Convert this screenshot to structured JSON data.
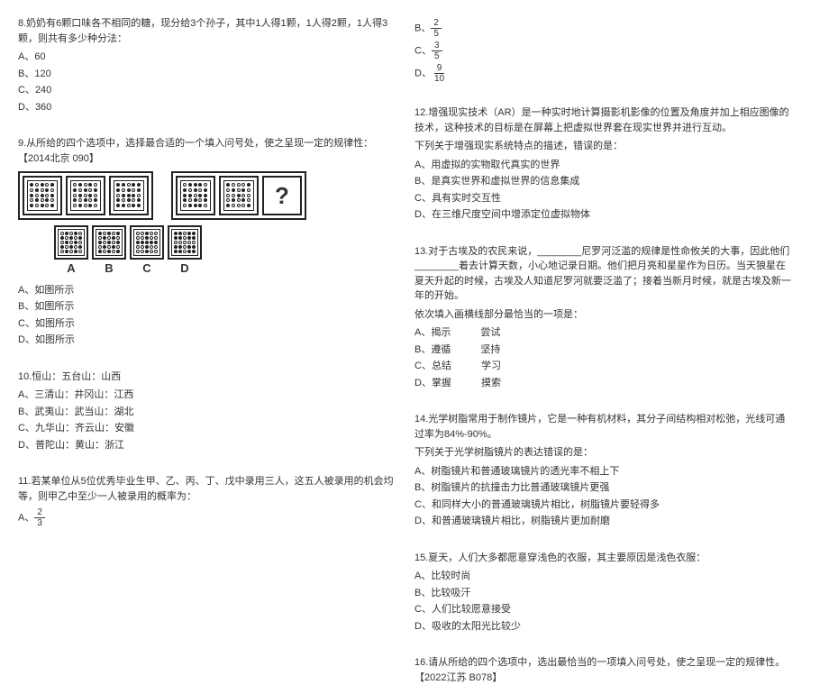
{
  "col1": {
    "q8": {
      "stem": "8.奶奶有6颗口味各不相同的糖，现分给3个孙子，其中1人得1颗，1人得2颗，1人得3颗，则共有多少种分法：",
      "opts": {
        "a": "A、60",
        "b": "B、120",
        "c": "C、240",
        "d": "D、360"
      }
    },
    "q9": {
      "stem": "9.从所给的四个选项中，选择最合适的一个填入问号处，使之呈现一定的规律性：【2014北京 090】",
      "qmark": "?",
      "ans_labels": {
        "a": "A",
        "b": "B",
        "c": "C",
        "d": "D"
      },
      "opts": {
        "a": "A、如图所示",
        "b": "B、如图所示",
        "c": "C、如图所示",
        "d": "D、如图所示"
      }
    },
    "q10": {
      "stem": "10.恒山：五台山：山西",
      "opts": {
        "a": "A、三清山：井冈山：江西",
        "b": "B、武夷山：武当山：湖北",
        "c": "C、九华山：齐云山：安徽",
        "d": "D、普陀山：黄山：浙江"
      }
    },
    "q11": {
      "stem": "11.若某单位从5位优秀毕业生甲、乙、丙、丁、戊中录用三人，这五人被录用的机会均等，则甲乙中至少一人被录用的概率为：",
      "frac_a": {
        "num": "2",
        "den": "3"
      },
      "opt_a_prefix": "A、"
    }
  },
  "col2": {
    "q11cont": {
      "b_prefix": "B、",
      "b_num": "2",
      "b_den": "5",
      "c_prefix": "C、",
      "c_num": "3",
      "c_den": "5",
      "d_prefix": "D、",
      "d_num": "9",
      "d_den": "10"
    },
    "q12": {
      "stem1": "12.增强现实技术（AR）是一种实时地计算摄影机影像的位置及角度并加上相应图像的技术，这种技术的目标是在屏幕上把虚拟世界套在现实世界并进行互动。",
      "stem2": "下列关于增强现实系统特点的描述，错误的是：",
      "opts": {
        "a": "A、用虚拟的实物取代真实的世界",
        "b": "B、是真实世界和虚拟世界的信息集成",
        "c": "C、具有实时交互性",
        "d": "D、在三维尺度空间中增添定位虚拟物体"
      }
    },
    "q13": {
      "stem1": "13.对于古埃及的农民来说，________尼罗河泛滥的规律是性命攸关的大事，因此他们________着去计算天数，小心地记录日期。他们把月亮和星星作为日历。当天狼星在夏天升起的时候，古埃及人知道尼罗河就要泛滥了；接着当新月时候，就是古埃及新一年的开始。",
      "stem2": "依次填入画横线部分最恰当的一项是：",
      "opts": {
        "a": "A、揭示　　　尝试",
        "b": "B、遵循　　　坚持",
        "c": "C、总结　　　学习",
        "d": "D、掌握　　　摸索"
      }
    },
    "q14": {
      "stem1": "14.光学树脂常用于制作镜片，它是一种有机材料，其分子间结构相对松弛，光线可通过率为84%-90%。",
      "stem2": "下列关于光学树脂镜片的表达错误的是：",
      "opts": {
        "a": "A、树脂镜片和普通玻璃镜片的透光率不相上下",
        "b": "B、树脂镜片的抗撞击力比普通玻璃镜片更强",
        "c": "C、和同样大小的普通玻璃镜片相比，树脂镜片要轻得多",
        "d": "D、和普通玻璃镜片相比，树脂镜片更加耐磨"
      }
    },
    "q15": {
      "stem": "15.夏天，人们大多都愿意穿浅色的衣服，其主要原因是浅色衣服：",
      "opts": {
        "a": "A、比较时尚",
        "b": "B、比较吸汗",
        "c": "C、人们比较愿意接受",
        "d": "D、吸收的太阳光比较少"
      }
    },
    "q16": {
      "stem": "16.请从所给的四个选项中，选出最恰当的一项填入问号处，使之呈现一定的规律性。【2022江苏 B078】"
    }
  }
}
